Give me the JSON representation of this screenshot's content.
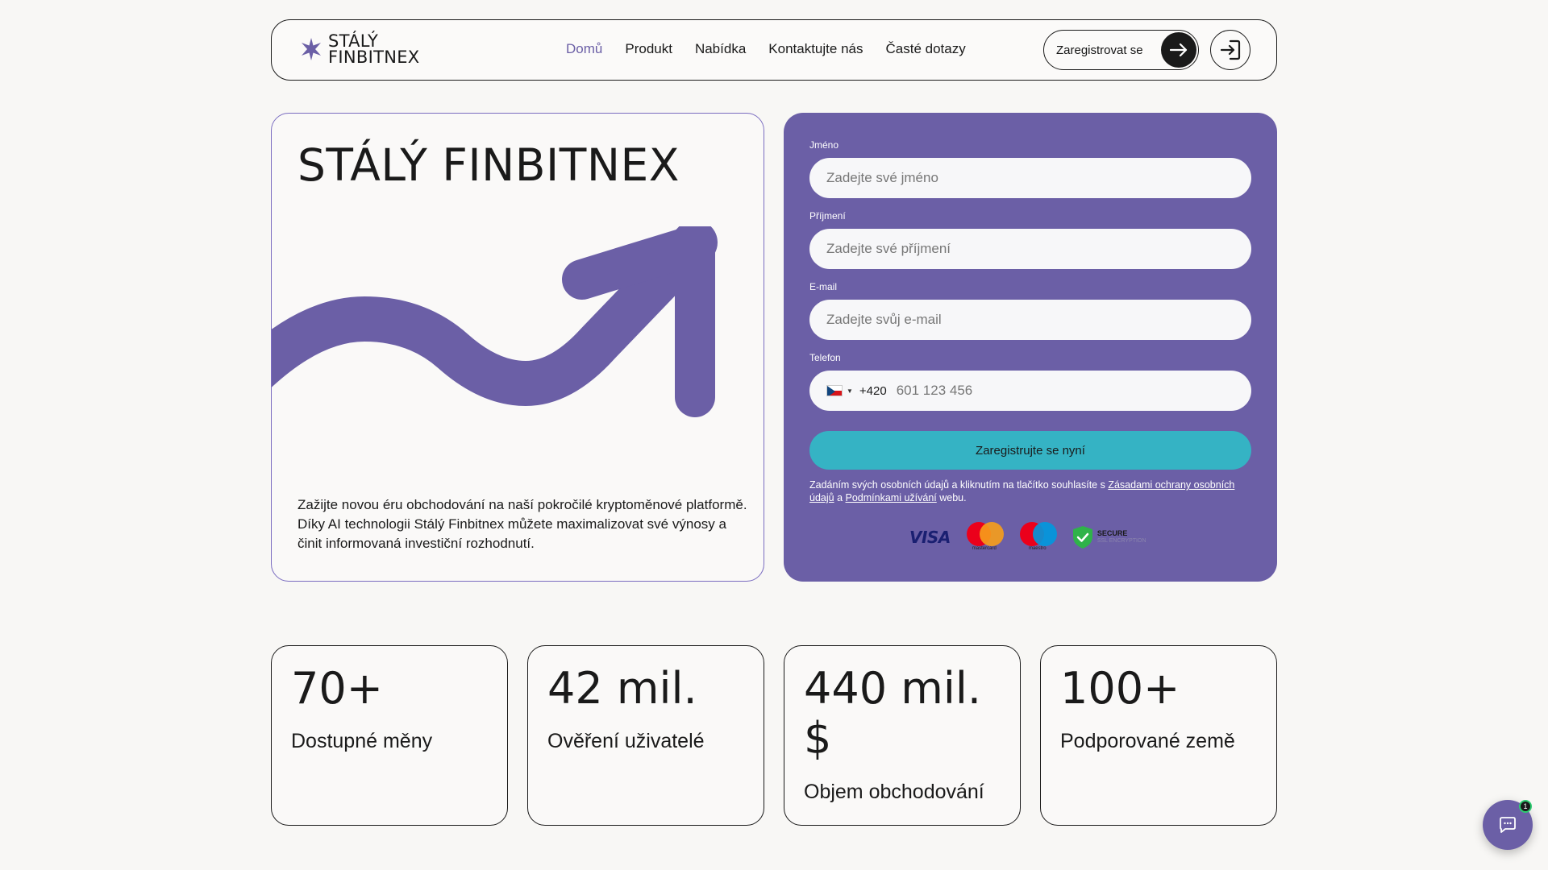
{
  "header": {
    "logo_line1": "STÁLÝ",
    "logo_line2": "FINBITNEX",
    "nav": [
      "Domů",
      "Produkt",
      "Nabídka",
      "Kontaktujte nás",
      "Časté dotazy"
    ],
    "register_label": "Zaregistrovat se",
    "accent_color": "#6b5fa6"
  },
  "hero": {
    "title": "STÁLÝ FINBITNEX",
    "text": "Zažijte novou éru obchodování na naší pokročilé kryptoměnové platformě. Díky AI technologii Stálý Finbitnex můžete maximalizovat své výnosy a činit informovaná investiční rozhodnutí."
  },
  "form": {
    "first_name_label": "Jméno",
    "first_name_placeholder": "Zadejte své jméno",
    "last_name_label": "Příjmení",
    "last_name_placeholder": "Zadejte své příjmení",
    "email_label": "E-mail",
    "email_placeholder": "Zadejte svůj e-mail",
    "phone_label": "Telefon",
    "dial_code": "+420",
    "phone_placeholder": "601 123 456",
    "submit_label": "Zaregistrujte se nyní",
    "consent_prefix": "Zadáním svých osobních údajů a kliknutím na tlačítko souhlasíte s ",
    "consent_link1": "Zásadami ochrany osobních údajů",
    "consent_mid": " a ",
    "consent_link2": "Podmínkami užívání",
    "consent_suffix": " webu.",
    "payments": {
      "visa": "VISA",
      "mastercard": "mastercard",
      "maestro": "maestro",
      "secure_title": "SECURE",
      "secure_sub": "SSL ENCRYPTION"
    },
    "background_color": "#6b5fa6",
    "button_color": "#35b3c4"
  },
  "stats": [
    {
      "value": "70+",
      "label": "Dostupné měny"
    },
    {
      "value": "42 mil.",
      "label": "Ověření uživatelé"
    },
    {
      "value": "440 mil. $",
      "label": "Objem obchodování"
    },
    {
      "value": "100+",
      "label": "Podporované země"
    }
  ],
  "chat": {
    "badge_count": "1"
  }
}
